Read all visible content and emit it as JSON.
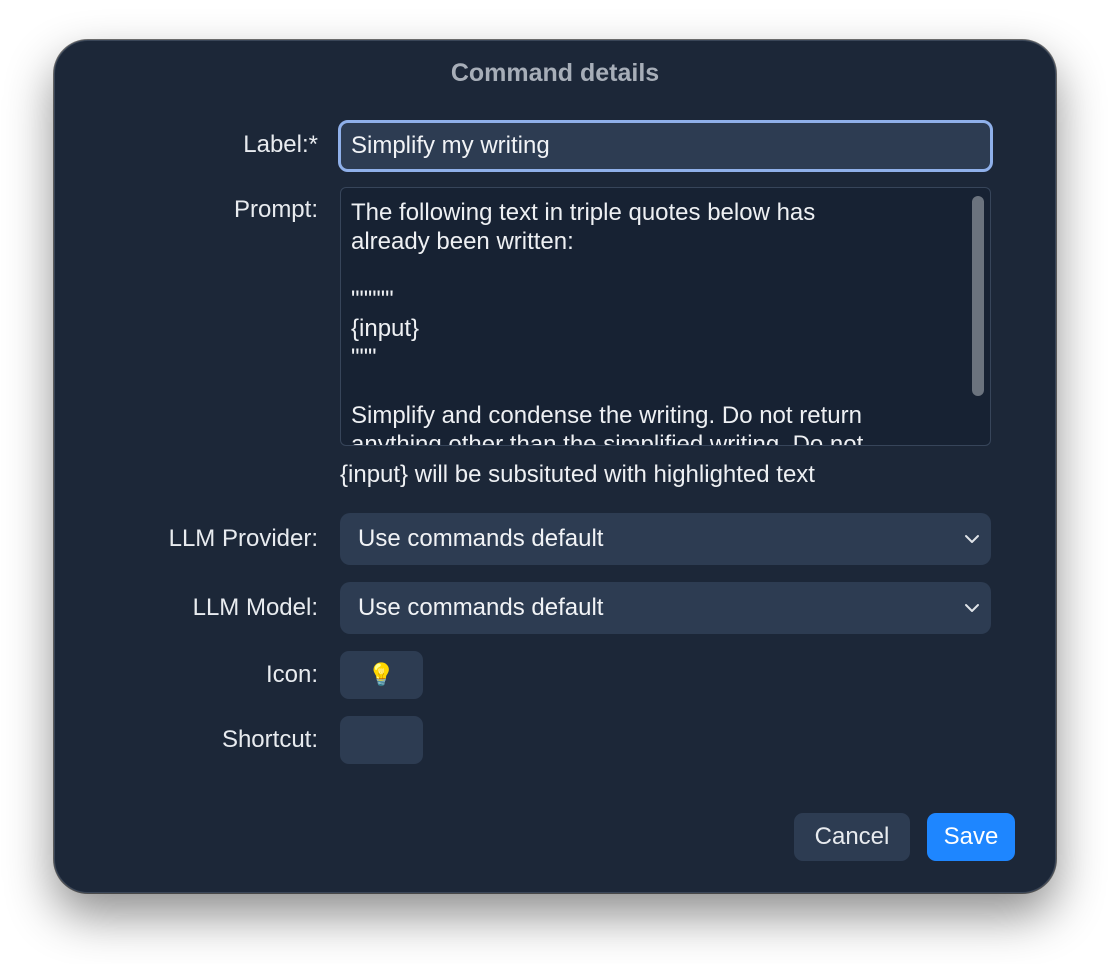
{
  "dialog": {
    "title": "Command details"
  },
  "form": {
    "label_caption": "Label:*",
    "label_value": "Simplify my writing",
    "prompt_caption": "Prompt:",
    "prompt_value": "The following text in triple quotes below has\nalready been written:\n\n\"\"\"\"\"\n{input}\n\"\"\"\n\nSimplify and condense the writing. Do not return\nanything other than the simplified writing. Do not",
    "prompt_hint": "{input} will be subsituted with highlighted text",
    "provider_caption": "LLM Provider:",
    "provider_value": "Use commands default",
    "model_caption": "LLM Model:",
    "model_value": "Use commands default",
    "icon_caption": "Icon:",
    "icon_glyph": "💡",
    "icon_name": "lightbulb-icon",
    "shortcut_caption": "Shortcut:",
    "shortcut_value": ""
  },
  "actions": {
    "cancel_label": "Cancel",
    "save_label": "Save"
  },
  "colors": {
    "dialog_bg": "#1c2738",
    "field_bg": "#2d3c52",
    "focus_ring": "#8fb0ea",
    "accent": "#1e86ff"
  }
}
